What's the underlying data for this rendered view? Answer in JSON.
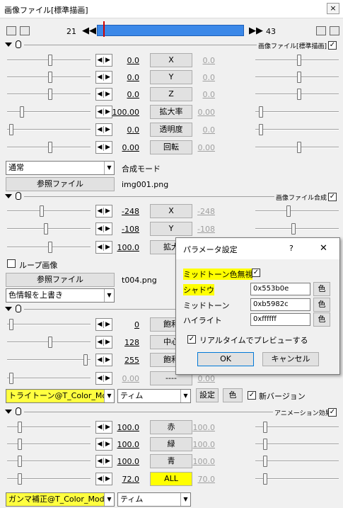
{
  "window": {
    "title": "画像ファイル[標準描画]",
    "close": "×"
  },
  "timeline": {
    "start": "21",
    "end": "43"
  },
  "sections": {
    "s1": {
      "title": "画像ファイル[標準描画]",
      "rows": [
        {
          "label": "X",
          "left": "0.0",
          "right": "0.0"
        },
        {
          "label": "Y",
          "left": "0.0",
          "right": "0.0"
        },
        {
          "label": "Z",
          "left": "0.0",
          "right": "0.0"
        },
        {
          "label": "拡大率",
          "left": "100.00",
          "right": "0.00"
        },
        {
          "label": "透明度",
          "left": "0.0",
          "right": "0.0"
        },
        {
          "label": "回転",
          "left": "0.00",
          "right": "0.00"
        }
      ],
      "blend": "通常",
      "blend_label": "合成モード",
      "ref_btn": "参照ファイル",
      "file": "img001.png"
    },
    "s2": {
      "title": "画像ファイル合成",
      "rows": [
        {
          "label": "X",
          "left": "-248",
          "right": "-248"
        },
        {
          "label": "Y",
          "left": "-108",
          "right": "-108"
        },
        {
          "label": "拡大",
          "left": "100.0",
          "right": ""
        }
      ],
      "loop": "ループ画像",
      "ref_btn": "参照ファイル",
      "file": "t004.png",
      "mode": "色情報を上書き"
    },
    "s3": {
      "rows": [
        {
          "label": "飽和",
          "left": "0",
          "right": ""
        },
        {
          "label": "中心",
          "left": "128",
          "right": ""
        },
        {
          "label": "飽和",
          "left": "255",
          "right": ""
        },
        {
          "label": "----",
          "left": "0.00",
          "right": "0.00"
        }
      ],
      "script": "トライトーン@T_Color_Modu",
      "sub": "ティム",
      "settings": "設定",
      "color": "色",
      "newver": "新バージョン"
    },
    "s4": {
      "title": "アニメーション効果",
      "rows": [
        {
          "label": "赤",
          "left": "100.0",
          "right": "100.0"
        },
        {
          "label": "緑",
          "left": "100.0",
          "right": "100.0"
        },
        {
          "label": "青",
          "left": "100.0",
          "right": "100.0"
        },
        {
          "label": "ALL",
          "left": "72.0",
          "right": "70.0"
        }
      ],
      "script": "ガンマ補正@T_Color_Mod",
      "sub": "ティム"
    }
  },
  "dialog": {
    "title": "パラメータ設定",
    "help": "?",
    "close": "✕",
    "nocolor": "ミッドトーン色無視",
    "fields": [
      {
        "label": "シャドウ",
        "value": "0x553b0e",
        "btn": "色"
      },
      {
        "label": "ミッドトーン",
        "value": "0xb5982c",
        "btn": "色"
      },
      {
        "label": "ハイライト",
        "value": "0xffffff",
        "btn": "色"
      }
    ],
    "preview": "リアルタイムでプレビューする",
    "ok": "OK",
    "cancel": "キャンセル"
  },
  "colors": {
    "highlight": "#ffff00",
    "timeline": "#3b88e8",
    "marker": "#d00000"
  }
}
